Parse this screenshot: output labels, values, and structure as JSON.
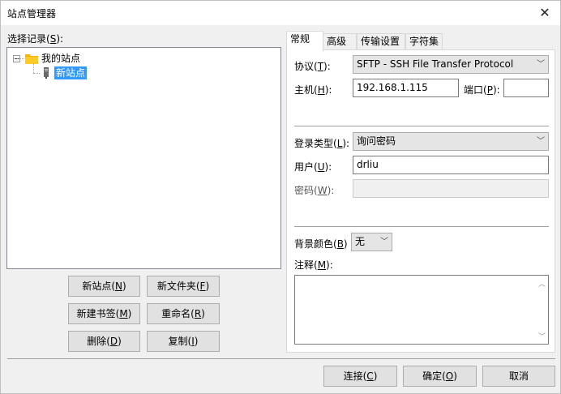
{
  "window": {
    "title": "站点管理器"
  },
  "left": {
    "select_label": "选择记录(",
    "select_key": "S",
    "select_tail": "):",
    "tree": {
      "root": "我的站点",
      "child": "新站点"
    },
    "buttons": {
      "new_site": {
        "text": "新站点(",
        "key": "N",
        "tail": ")"
      },
      "new_folder": {
        "text": "新文件夹(",
        "key": "F",
        "tail": ")"
      },
      "new_bookmark": {
        "text": "新建书签(",
        "key": "M",
        "tail": ")"
      },
      "rename": {
        "text": "重命名(",
        "key": "R",
        "tail": ")"
      },
      "delete": {
        "text": "删除(",
        "key": "D",
        "tail": ")"
      },
      "copy": {
        "text": "复制(",
        "key": "I",
        "tail": ")"
      }
    }
  },
  "tabs": [
    "常规",
    "高级",
    "传输设置",
    "字符集"
  ],
  "form": {
    "protocol_label": {
      "text": "协议(",
      "key": "T",
      "tail": "):"
    },
    "protocol_value": "SFTP - SSH File Transfer Protocol",
    "host_label": {
      "text": "主机(",
      "key": "H",
      "tail": "):"
    },
    "host_value": "192.168.1.115",
    "port_label": {
      "text": "端口(",
      "key": "P",
      "tail": "):"
    },
    "port_value": "",
    "logon_label": {
      "text": "登录类型(",
      "key": "L",
      "tail": "):"
    },
    "logon_value": "询问密码",
    "user_label": {
      "text": "用户(",
      "key": "U",
      "tail": "):"
    },
    "user_value": "drliu",
    "password_label": {
      "text": "密码(",
      "key": "W",
      "tail": "):"
    },
    "bg_label": {
      "text": "背景颜色(",
      "key": "B",
      "tail": ")"
    },
    "bg_value": "无",
    "comment_label": {
      "text": "注释(",
      "key": "M",
      "tail": "):"
    }
  },
  "footer": {
    "connect": {
      "text": "连接(",
      "key": "C",
      "tail": ")"
    },
    "ok": {
      "text": "确定(",
      "key": "O",
      "tail": ")"
    },
    "cancel": "取消"
  },
  "colors": {
    "selection": "#3399ff",
    "folder": "#f4b400"
  }
}
